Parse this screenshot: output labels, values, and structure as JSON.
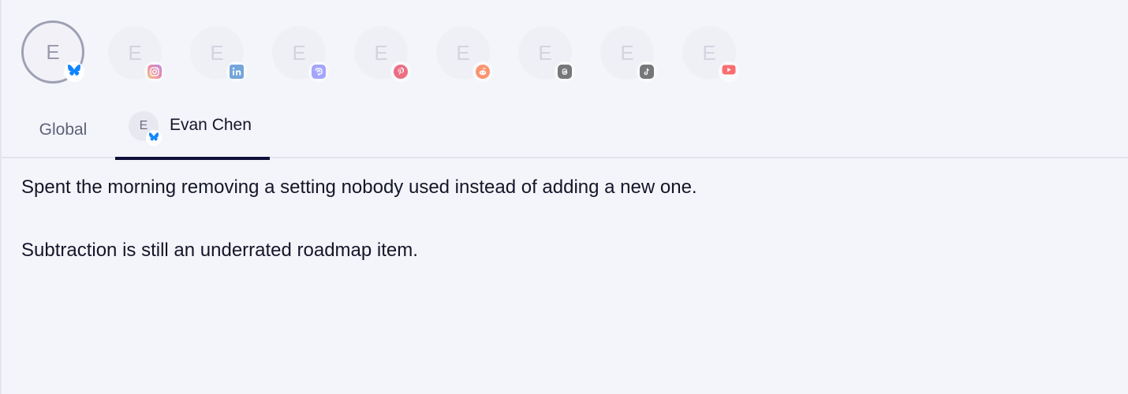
{
  "avatars": [
    {
      "letter": "E",
      "platform": "bluesky",
      "icon": "butterfly-icon",
      "color": "#1185fe",
      "selected": true
    },
    {
      "letter": "E",
      "platform": "instagram",
      "icon": "instagram-icon",
      "color": "#e1306c",
      "selected": false
    },
    {
      "letter": "E",
      "platform": "linkedin",
      "icon": "linkedin-icon",
      "color": "#0a66c2",
      "selected": false
    },
    {
      "letter": "E",
      "platform": "mastodon",
      "icon": "mastodon-icon",
      "color": "#6364ff",
      "selected": false
    },
    {
      "letter": "E",
      "platform": "pinterest",
      "icon": "pinterest-icon",
      "color": "#e60023",
      "selected": false
    },
    {
      "letter": "E",
      "platform": "reddit",
      "icon": "reddit-icon",
      "color": "#ff4500",
      "selected": false
    },
    {
      "letter": "E",
      "platform": "threads",
      "icon": "threads-icon",
      "color": "#000000",
      "selected": false
    },
    {
      "letter": "E",
      "platform": "tiktok",
      "icon": "tiktok-icon",
      "color": "#000000",
      "selected": false
    },
    {
      "letter": "E",
      "platform": "youtube",
      "icon": "youtube-icon",
      "color": "#ff0000",
      "selected": false
    }
  ],
  "tabs": {
    "global_label": "Global",
    "user_tab": {
      "avatar_letter": "E",
      "name": "Evan Chen",
      "platform_icon": "butterfly-icon"
    }
  },
  "post": {
    "paragraphs": [
      "Spent the morning removing a setting nobody used instead of adding a new one.",
      "Subtraction is still an underrated roadmap item."
    ]
  }
}
